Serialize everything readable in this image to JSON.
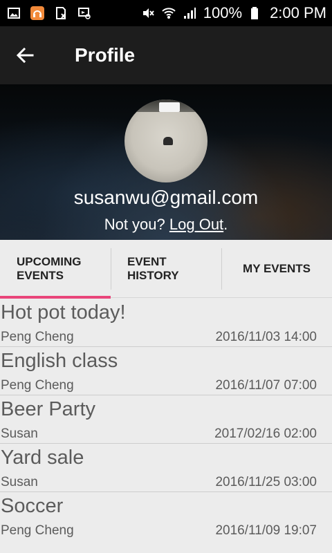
{
  "status_bar": {
    "battery_text": "100%",
    "time": "2:00 PM",
    "icons": [
      "image-icon",
      "headphones-app-icon",
      "sim-card-icon",
      "cast-icon",
      "mute-icon",
      "wifi-icon",
      "signal-icon",
      "battery-icon"
    ]
  },
  "app_bar": {
    "title": "Profile",
    "back_icon": "arrow-back-icon"
  },
  "profile": {
    "email": "susanwu@gmail.com",
    "not_you": "Not you?",
    "logout": "Log Out",
    "period": "."
  },
  "tabs": [
    {
      "line1": "UPCOMING",
      "line2": "EVENTS",
      "active": true
    },
    {
      "line1": "EVENT",
      "line2": "HISTORY",
      "active": false
    },
    {
      "line1": "MY EVENTS",
      "line2": "",
      "active": false
    }
  ],
  "events": [
    {
      "title": "Hot pot today!",
      "host": "Peng Cheng",
      "date": "2016/11/03 14:00"
    },
    {
      "title": "English class",
      "host": "Peng Cheng",
      "date": "2016/11/07 07:00"
    },
    {
      "title": "Beer Party",
      "host": "Susan",
      "date": "2017/02/16 02:00"
    },
    {
      "title": "Yard sale",
      "host": "Susan",
      "date": "2016/11/25 03:00"
    },
    {
      "title": "Soccer",
      "host": "Peng Cheng",
      "date": "2016/11/09 19:07"
    }
  ],
  "colors": {
    "accent": "#e9457a",
    "app_bar": "#1d1d1d",
    "list_background": "#ececec"
  }
}
